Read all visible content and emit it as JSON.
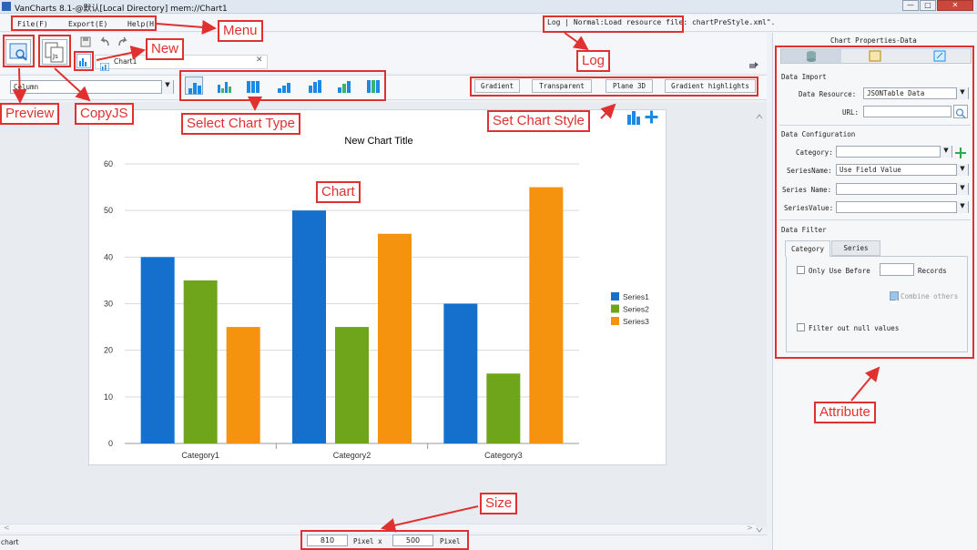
{
  "window": {
    "title": "VanCharts 8.1-@默认[Local Directory]    mem://Chart1",
    "controls": [
      "—",
      "□",
      "✕"
    ]
  },
  "menu": {
    "items": [
      "File(F)",
      "Export(E)",
      "Help(H)"
    ]
  },
  "log": {
    "text": "Log | Normal:Load resource file: chartPreStyle.xml\"."
  },
  "editor": {
    "tab_label": "Chart1",
    "close": "✕",
    "chart_type_select": "Column",
    "styles": [
      "Gradient",
      "Transparent",
      "Plane 3D",
      "Gradient highlights"
    ]
  },
  "status": {
    "left": "chart",
    "width": "810",
    "height": "500",
    "unit_x": "Pixel x",
    "unit": "Pixel"
  },
  "panel": {
    "title": "Chart Properties-Data",
    "data_import": "Data Import",
    "data_resource_label": "Data Resource:",
    "data_resource_value": "JSONTable Data",
    "url_label": "URL:",
    "url_value": "",
    "data_config": "Data Configuration",
    "category_label": "Category:",
    "category_value": "",
    "series_name_mode_label": "SeriesName:",
    "series_name_mode_value": "Use Field Value",
    "series_name_label": "Series Name:",
    "series_name_value": "",
    "series_value_label": "SeriesValue:",
    "series_value_value": "",
    "data_filter": "Data Filter",
    "filter_tabs": [
      "Category",
      "Series"
    ],
    "only_use_before": "Only Use Before",
    "records": "Records",
    "records_value": "",
    "combine_others": "Combine others",
    "filter_null": "Filter out null values"
  },
  "annotations": {
    "menu": "Menu",
    "new": "New",
    "log": "Log",
    "preview": "Preview",
    "copyjs": "CopyJS",
    "select_type": "Select Chart Type",
    "set_style": "Set Chart Style",
    "chart": "Chart",
    "size": "Size",
    "attribute": "Attribute"
  },
  "colors": {
    "series1": "#1470cc",
    "series2": "#6fa51a",
    "series3": "#f5930f",
    "annotation": "#e03030",
    "chart_icon": "#1e88e5"
  },
  "chart_data": {
    "type": "bar",
    "title": "New Chart Title",
    "categories": [
      "Category1",
      "Category2",
      "Category3"
    ],
    "series": [
      {
        "name": "Series1",
        "values": [
          40,
          50,
          30
        ]
      },
      {
        "name": "Series2",
        "values": [
          35,
          25,
          15
        ]
      },
      {
        "name": "Series3",
        "values": [
          25,
          45,
          55
        ]
      }
    ],
    "ylim": [
      0,
      60
    ],
    "yticks": [
      0,
      10,
      20,
      30,
      40,
      50,
      60
    ],
    "grid": true,
    "legend": "right"
  }
}
